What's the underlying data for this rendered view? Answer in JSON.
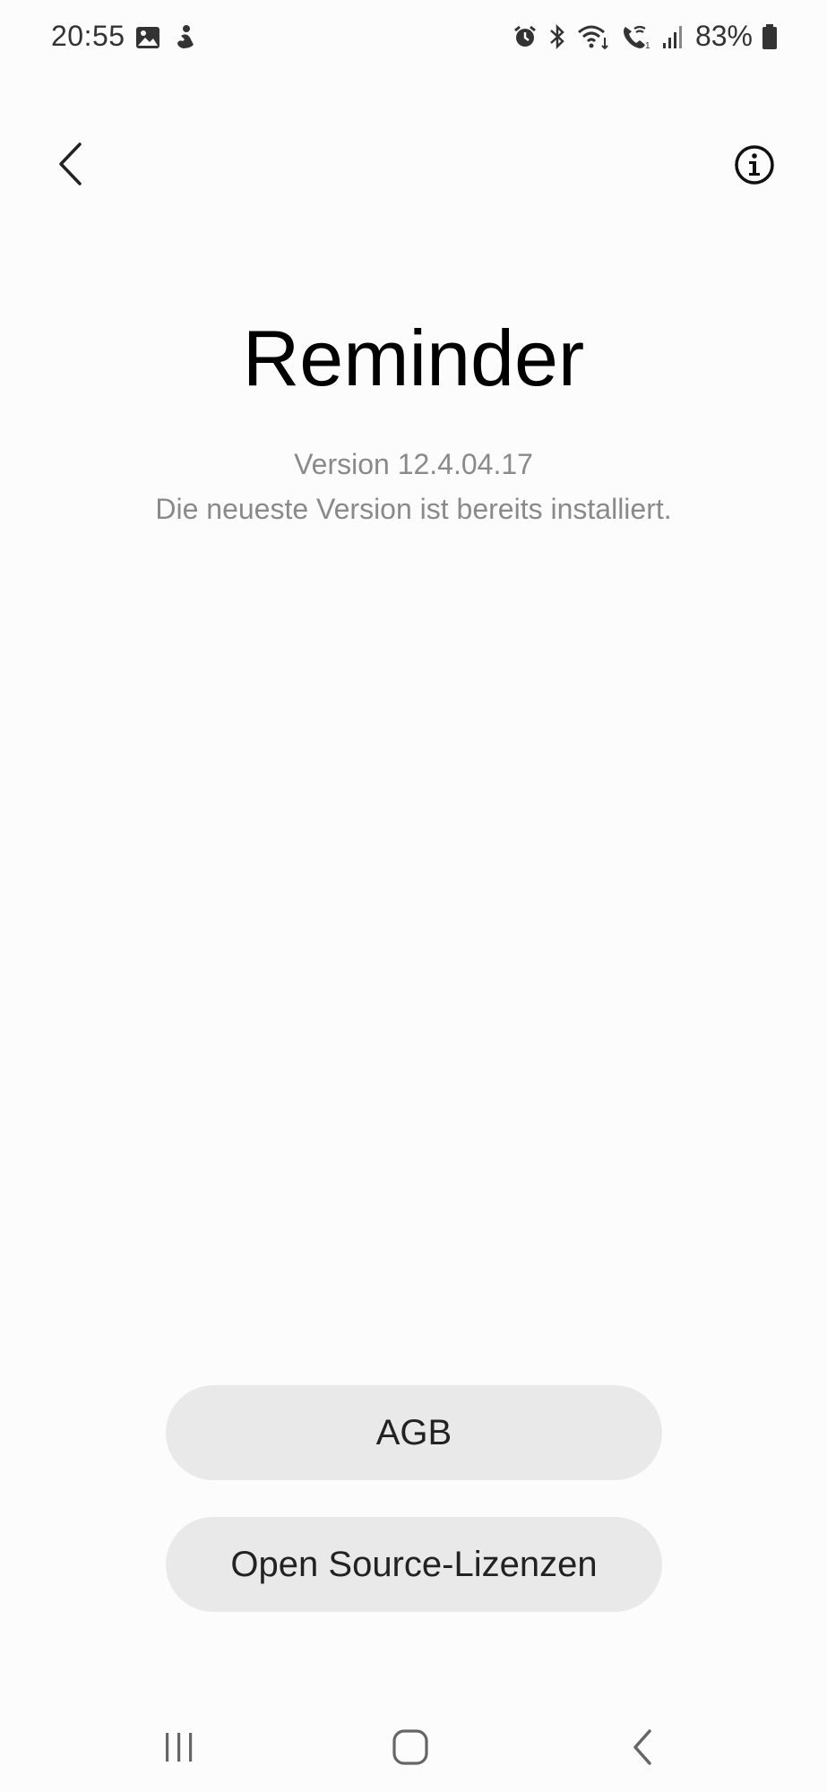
{
  "status_bar": {
    "time": "20:55",
    "left_icons": [
      "gallery-icon",
      "notification-app-icon"
    ],
    "right_icons": [
      "alarm-icon",
      "bluetooth-icon",
      "wifi-icon",
      "wifi-calling-icon",
      "signal-icon",
      "battery-icon"
    ],
    "battery": "83%"
  },
  "header": {
    "back_icon": "chevron-left-icon",
    "info_icon": "info-icon"
  },
  "app": {
    "name": "Reminder",
    "version": "Version 12.4.04.17",
    "status": "Die neueste Version ist bereits installiert."
  },
  "buttons": {
    "agb": "AGB",
    "open_source": "Open Source-Lizenzen"
  },
  "nav_bar": {
    "items": [
      "recents-icon",
      "home-icon",
      "back-icon"
    ]
  },
  "colors": {
    "background": "#fcfcfc",
    "button_bg": "#e9e9e9",
    "secondary_text": "#8a8a8a"
  }
}
